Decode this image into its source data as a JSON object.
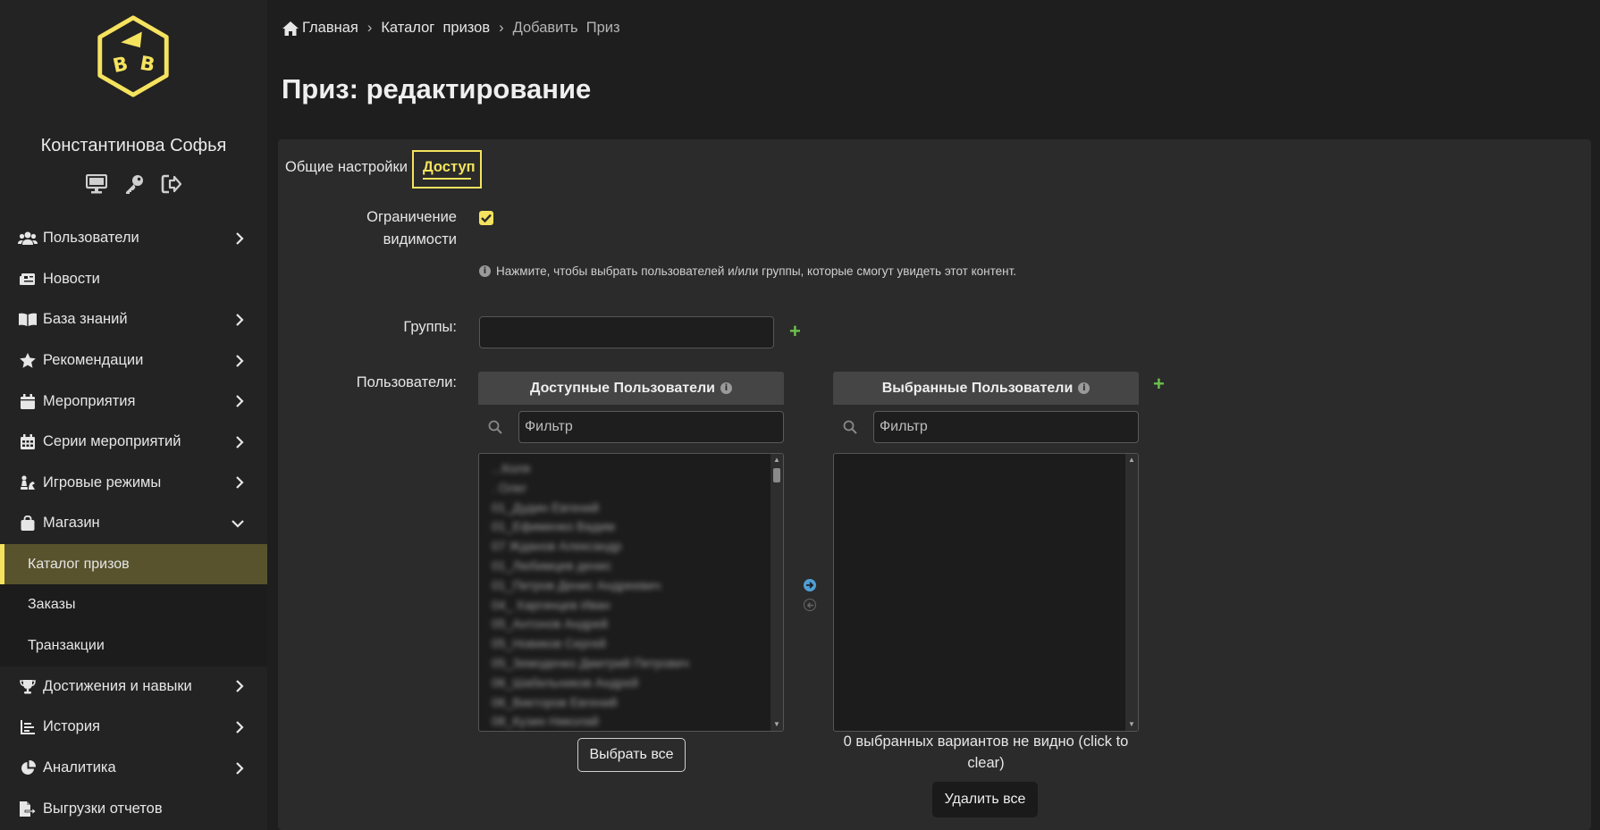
{
  "user": {
    "name": "Константинова Софья"
  },
  "user_actions": [
    "monitor-icon",
    "key-icon",
    "logout-icon"
  ],
  "colors": {
    "accent": "#f5e35f",
    "active_bg": "#58532c",
    "plus": "#6cc04a",
    "arrow_active": "#4e9fd6"
  },
  "nav": {
    "users": "Пользователи",
    "news": "Новости",
    "knowledge": "База знаний",
    "recommendations": "Рекомендации",
    "events": "Мероприятия",
    "event_series": "Серии мероприятий",
    "game_modes": "Игровые режимы",
    "shop": "Магазин",
    "shop_sub": {
      "catalog": "Каталог призов",
      "orders": "Заказы",
      "transactions": "Транзакции"
    },
    "achievements": "Достижения и навыки",
    "history": "История",
    "analytics": "Аналитика",
    "reports": "Выгрузки отчетов"
  },
  "breadcrumb": {
    "home": "Главная",
    "catalog": "Каталог  призов",
    "current": "Добавить  Приз"
  },
  "page_title": "Приз: редактирование",
  "tabs": {
    "general": "Общие настройки",
    "access": "Доступ"
  },
  "form": {
    "visibility_label_1": "Ограничение",
    "visibility_label_2": "видимости",
    "visibility_checked": true,
    "help_text": "Нажмите, чтобы выбрать пользователей и/или группы, которые смогут увидеть этот контент.",
    "groups_label": "Группы:",
    "users_label": "Пользователи:"
  },
  "selector": {
    "available_title": "Доступные Пользователи",
    "selected_title": "Выбранные Пользователи",
    "filter_placeholder": "Фильтр",
    "available_items": [
      "...Коля",
      ". Олег",
      "01_Дудин Евгений",
      "01_Ефименко Вадим",
      "07 Жданов Александр",
      "01_Любимцев денис",
      "01_Петров Денис Андреевич",
      "04_ Харгинцев Иван",
      "05_Антонов Андрей",
      "05_Новиков Сергей",
      "05_Земоденко Дмитрий Петрович",
      "06_Шабельников Андрей",
      "06_Викторов Евгений",
      "08_Кузин Николай"
    ],
    "select_all": "Выбрать все",
    "hidden_info": "0 выбранных вариантов не видно (click to clear)",
    "delete_all": "Удалить все"
  }
}
